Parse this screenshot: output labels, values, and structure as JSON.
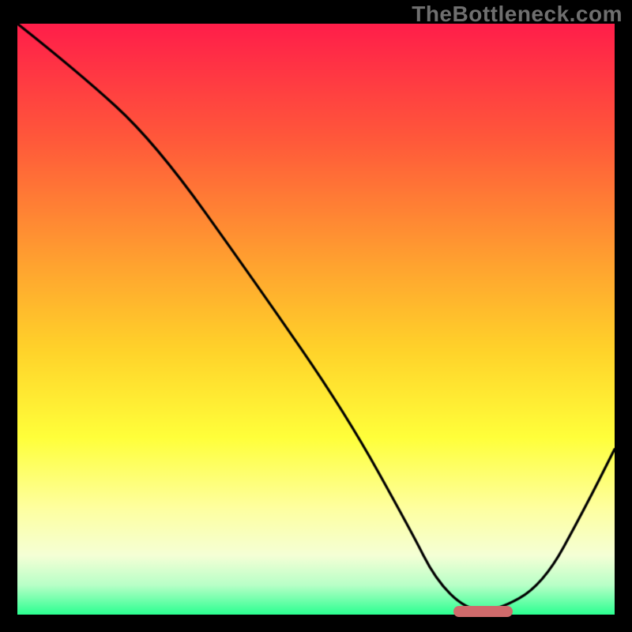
{
  "watermark": "TheBottleneck.com",
  "colors": {
    "frame": "#000000",
    "curve": "#000000",
    "marker": "#cf6a6b",
    "gradient_stops": [
      {
        "t": 0.0,
        "c": "#ff1e4a"
      },
      {
        "t": 0.2,
        "c": "#ff5a3a"
      },
      {
        "t": 0.4,
        "c": "#ffa030"
      },
      {
        "t": 0.55,
        "c": "#ffd22a"
      },
      {
        "t": 0.7,
        "c": "#ffff3a"
      },
      {
        "t": 0.82,
        "c": "#feffa0"
      },
      {
        "t": 0.9,
        "c": "#f5ffd6"
      },
      {
        "t": 0.95,
        "c": "#b8ffc7"
      },
      {
        "t": 1.0,
        "c": "#2bff91"
      }
    ]
  },
  "chart_data": {
    "type": "line",
    "title": "",
    "xlabel": "",
    "ylabel": "",
    "xlim": [
      0,
      100
    ],
    "ylim": [
      0,
      100
    ],
    "series": [
      {
        "name": "curve",
        "x": [
          0,
          10,
          23,
          40,
          55,
          66,
          70,
          75,
          80,
          88,
          95,
          100
        ],
        "values": [
          100,
          92,
          80,
          56,
          34,
          14,
          6,
          1,
          0.5,
          5,
          18,
          28
        ]
      }
    ],
    "marker": {
      "x_start": 73,
      "x_end": 83,
      "y": 0.5
    }
  }
}
